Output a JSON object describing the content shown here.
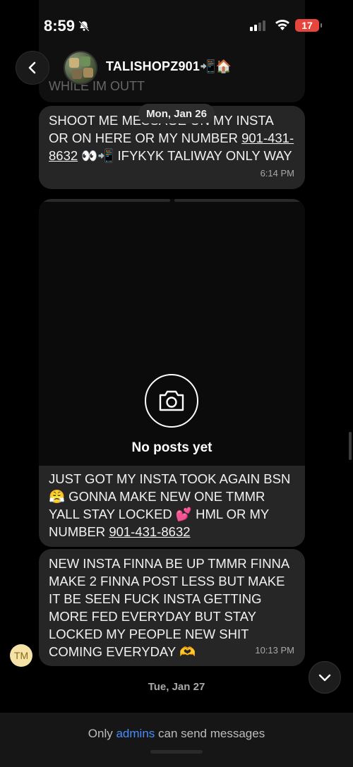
{
  "status_bar": {
    "time": "8:59",
    "battery": "17"
  },
  "header": {
    "channel_name": "TALISHOPZ901📲🏠",
    "faded_message": "WHILE IM OUTT"
  },
  "date_separators": {
    "first": "Mon, Jan 26",
    "second": "Tue, Jan 27"
  },
  "messages": [
    {
      "text_before": "SHOOT ME MESSAGE ON MY INSTA OR ON HERE OR MY NUMBER ",
      "phone": "901-431-8632",
      "text_after": " 👀📲 IFYKYK TALIWAY ONLY WAY",
      "time": "6:14 PM"
    },
    {
      "post_empty_label": "No posts yet",
      "text_before": "JUST GOT MY INSTA TOOK AGAIN BSN 😤 GONNA MAKE NEW ONE TMMR YALL STAY LOCKED 💕 HML OR MY NUMBER ",
      "phone": "901-431-8632"
    },
    {
      "text": "NEW INSTA FINNA BE UP TMMR FINNA MAKE 2 FINNA POST LESS BUT MAKE IT BE SEEN FUCK INSTA GETTING MORE FED EVERYDAY BUT STAY LOCKED MY PEOPLE NEW SHIT COMING EVERYDAY 🫶",
      "time": "10:13 PM",
      "sender_initials": "TM"
    }
  ],
  "footer": {
    "prefix": "Only ",
    "link": "admins",
    "suffix": " can send messages"
  },
  "icons": {
    "back": "chevron-left-icon",
    "mute": "bell-slash-icon",
    "camera": "camera-icon",
    "scroll_down": "chevron-down-icon"
  },
  "colors": {
    "background": "#000000",
    "bubble": "#262626",
    "link": "#4a8cf7",
    "battery": "#e5453b"
  }
}
